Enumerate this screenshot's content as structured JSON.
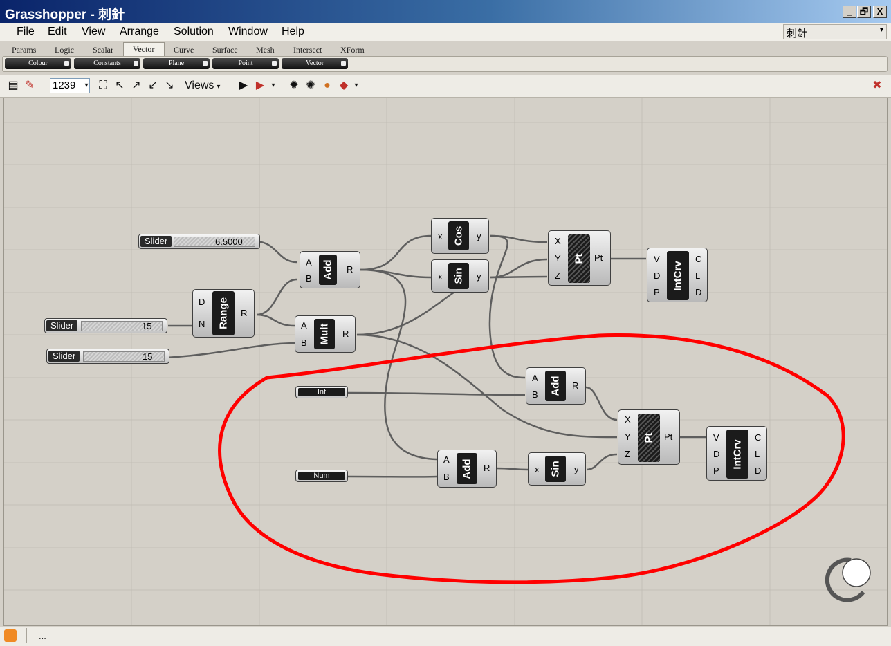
{
  "window": {
    "title": "Grasshopper - 刺針",
    "minimize": "_",
    "restore": "🗗",
    "close": "X"
  },
  "menu": [
    "File",
    "Edit",
    "View",
    "Arrange",
    "Solution",
    "Window",
    "Help"
  ],
  "document_selector": "刺針",
  "tabs": [
    "Params",
    "Logic",
    "Scalar",
    "Vector",
    "Curve",
    "Surface",
    "Mesh",
    "Intersect",
    "XForm"
  ],
  "active_tab": "Vector",
  "panels": [
    "Colour",
    "Constants",
    "Plane",
    "Point",
    "Vector"
  ],
  "toolbar": {
    "zoom": "1239",
    "views_label": "Views"
  },
  "status": {
    "text": "..."
  },
  "canvas": {
    "sliders": [
      {
        "label": "Slider",
        "value": "6.5000"
      },
      {
        "label": "Slider",
        "value": "15"
      },
      {
        "label": "Slider",
        "value": "15"
      }
    ],
    "params": [
      {
        "label": "Int"
      },
      {
        "label": "Num"
      }
    ],
    "components": {
      "range": {
        "name": "Range",
        "inputs": [
          "D",
          "N"
        ],
        "outputs": [
          "R"
        ]
      },
      "add1": {
        "name": "Add",
        "inputs": [
          "A",
          "B"
        ],
        "outputs": [
          "R"
        ]
      },
      "mult": {
        "name": "Mult",
        "inputs": [
          "A",
          "B"
        ],
        "outputs": [
          "R"
        ]
      },
      "cos": {
        "name": "Cos",
        "inputs": [
          "x"
        ],
        "outputs": [
          "y"
        ]
      },
      "sin1": {
        "name": "Sin",
        "inputs": [
          "x"
        ],
        "outputs": [
          "y"
        ]
      },
      "pt1": {
        "name": "Pt",
        "inputs": [
          "X",
          "Y",
          "Z"
        ],
        "outputs": [
          "Pt"
        ]
      },
      "intcrv1": {
        "name": "IntCrv",
        "inputs": [
          "V",
          "D",
          "P"
        ],
        "outputs": [
          "C",
          "L",
          "D"
        ]
      },
      "add2": {
        "name": "Add",
        "inputs": [
          "A",
          "B"
        ],
        "outputs": [
          "R"
        ]
      },
      "pt2": {
        "name": "Pt",
        "inputs": [
          "X",
          "Y",
          "Z"
        ],
        "outputs": [
          "Pt"
        ]
      },
      "intcrv2": {
        "name": "IntCrv",
        "inputs": [
          "V",
          "D",
          "P"
        ],
        "outputs": [
          "C",
          "L",
          "D"
        ]
      },
      "add3": {
        "name": "Add",
        "inputs": [
          "A",
          "B"
        ],
        "outputs": [
          "R"
        ]
      },
      "sin2": {
        "name": "Sin",
        "inputs": [
          "x"
        ],
        "outputs": [
          "y"
        ]
      }
    },
    "annotation_color": "#ff0000",
    "wire_color": "#5e5e5e"
  }
}
